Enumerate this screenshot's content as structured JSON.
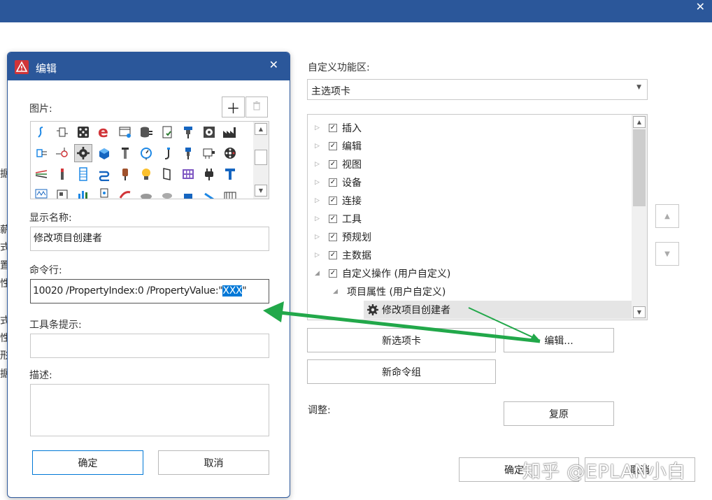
{
  "main": {
    "ribbon_label": "自定义功能区:",
    "ribbon_select_value": "主选项卡",
    "tree": [
      {
        "label": "插入",
        "expander": "collapsed",
        "checked": true
      },
      {
        "label": "编辑",
        "expander": "collapsed",
        "checked": true
      },
      {
        "label": "视图",
        "expander": "collapsed",
        "checked": true
      },
      {
        "label": "设备",
        "expander": "collapsed",
        "checked": true
      },
      {
        "label": "连接",
        "expander": "collapsed",
        "checked": true
      },
      {
        "label": "工具",
        "expander": "collapsed",
        "checked": true
      },
      {
        "label": "预规划",
        "expander": "collapsed",
        "checked": true
      },
      {
        "label": "主数据",
        "expander": "collapsed",
        "checked": true
      },
      {
        "label": "自定义操作 (用户自定义)",
        "expander": "expanded",
        "checked": true
      },
      {
        "label": "项目属性 (用户自定义)",
        "expander": "expanded",
        "checked": false
      },
      {
        "label": "修改项目创建者",
        "expander": "none",
        "checked": false,
        "icon": "gear-icon",
        "selected": true
      }
    ],
    "new_tab_button": "新选项卡",
    "edit_button": "编辑...",
    "new_group_button": "新命令组",
    "adjust_label": "调整:",
    "reset_button": "复原",
    "ok_button": "确定",
    "cancel_button": "取消",
    "watermark": "知乎 @EPLAN小白",
    "left_fragments": [
      "据",
      "薪",
      "式",
      "置",
      "性",
      "式",
      "性",
      "形",
      "据"
    ]
  },
  "dialog": {
    "title": "编辑",
    "image_label": "图片:",
    "display_name_label": "显示名称:",
    "display_name_value": "修改项目创建者",
    "command_line_label": "命令行:",
    "command_line_prefix": "10020 /PropertyIndex:0 /PropertyValue:\"",
    "command_line_selected": "XXX",
    "command_line_suffix": "\"",
    "tooltip_label": "工具条提示:",
    "tooltip_value": "",
    "description_label": "描述:",
    "description_value": "",
    "ok_button": "确定",
    "cancel_button": "取消"
  },
  "colors": {
    "title_bar": "#2b579a",
    "selection": "#0078d7",
    "annotation_arrow": "#22a84a"
  }
}
